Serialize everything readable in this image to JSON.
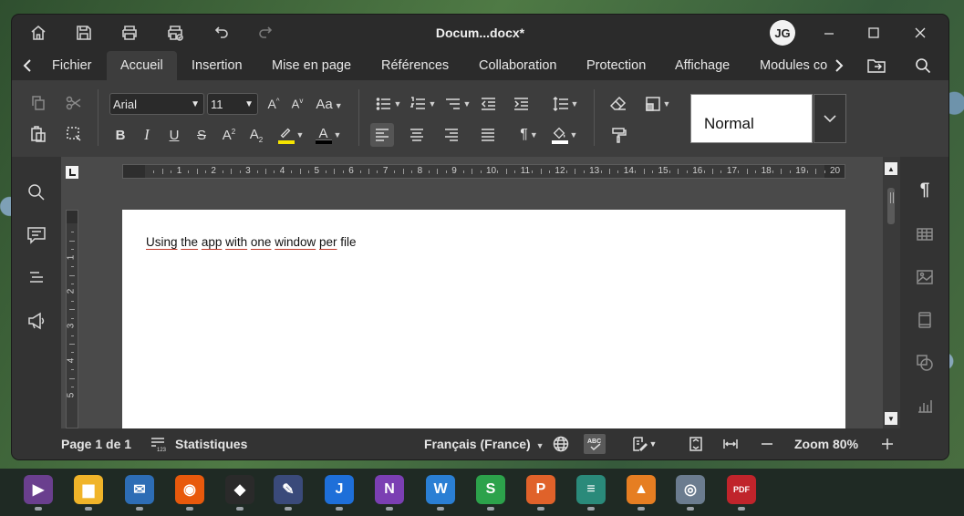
{
  "window": {
    "title": "Docum...docx*",
    "user_initials": "JG"
  },
  "tabs": [
    {
      "label": "Fichier"
    },
    {
      "label": "Accueil"
    },
    {
      "label": "Insertion"
    },
    {
      "label": "Mise en page"
    },
    {
      "label": "Références"
    },
    {
      "label": "Collaboration"
    },
    {
      "label": "Protection"
    },
    {
      "label": "Affichage"
    },
    {
      "label": "Modules co"
    }
  ],
  "active_tab": "Accueil",
  "ribbon": {
    "font_name": "Arial",
    "font_size": "11",
    "style_name": "Normal",
    "highlight_color": "#f5e400",
    "font_color": "#000000"
  },
  "ruler": {
    "h_numbers": [
      "1",
      "2",
      "3",
      "4",
      "5",
      "6",
      "7",
      "8",
      "9",
      "10",
      "11",
      "12",
      "13",
      "14",
      "15",
      "16",
      "17",
      "18",
      "19",
      "20"
    ],
    "v_numbers": [
      "1",
      "2",
      "3",
      "4",
      "5"
    ]
  },
  "document": {
    "words": [
      {
        "text": "Using",
        "flagged": true
      },
      {
        "text": "the",
        "flagged": true
      },
      {
        "text": "app",
        "flagged": true
      },
      {
        "text": "with",
        "flagged": true
      },
      {
        "text": "one",
        "flagged": true
      },
      {
        "text": "window",
        "flagged": true
      },
      {
        "text": "per",
        "flagged": true
      },
      {
        "text": "file",
        "flagged": false
      }
    ]
  },
  "status": {
    "page": "Page 1 de 1",
    "stats_label": "Statistiques",
    "language": "Français (France)",
    "zoom": "Zoom 80%"
  },
  "taskbar": {
    "apps": [
      {
        "icon": "media-player-icon",
        "color": "#6a3f8e",
        "glyph": "▶"
      },
      {
        "icon": "file-explorer-icon",
        "color": "#f0b429",
        "glyph": "▆"
      },
      {
        "icon": "thunderbird-icon",
        "color": "#2d6db5",
        "glyph": "✉"
      },
      {
        "icon": "firefox-icon",
        "color": "#e8590c",
        "glyph": "◉"
      },
      {
        "icon": "inkscape-icon",
        "color": "#2a2a2a",
        "glyph": "◆"
      },
      {
        "icon": "drawing-app-icon",
        "color": "#3a4a7a",
        "glyph": "✎"
      },
      {
        "icon": "joplin-icon",
        "color": "#1e6fd9",
        "glyph": "J"
      },
      {
        "icon": "onenote-icon",
        "color": "#7b3fb3",
        "glyph": "N"
      },
      {
        "icon": "writer-icon",
        "color": "#2a7fd4",
        "glyph": "W"
      },
      {
        "icon": "spreadsheet-icon",
        "color": "#2ca24b",
        "glyph": "S"
      },
      {
        "icon": "presentation-icon",
        "color": "#e0622a",
        "glyph": "P"
      },
      {
        "icon": "layers-app-icon",
        "color": "#2a8a7a",
        "glyph": "≡"
      },
      {
        "icon": "vlc-icon",
        "color": "#e67e22",
        "glyph": "▲"
      },
      {
        "icon": "camera-icon",
        "color": "#6b7c8f",
        "glyph": "◎"
      },
      {
        "icon": "pdf-editor-icon",
        "color": "#c0242b",
        "glyph": "PDF"
      }
    ]
  }
}
